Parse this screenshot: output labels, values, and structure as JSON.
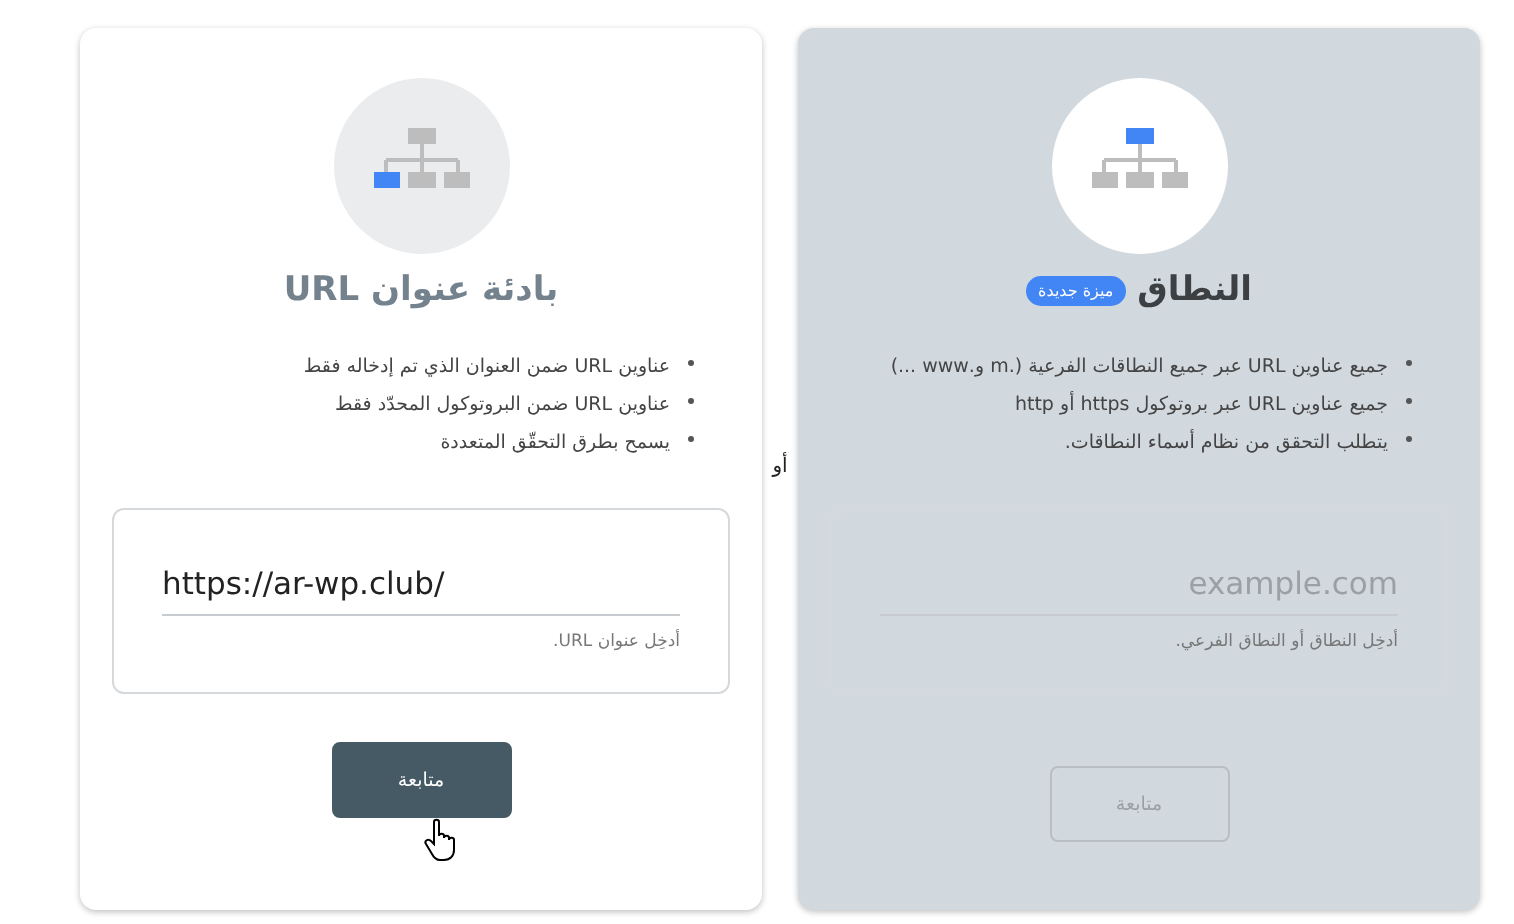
{
  "separator": "أو",
  "cards": [
    {
      "kind": "domain",
      "selected": false,
      "title": "النطاق",
      "badge": "ميزة جديدة",
      "bullets": [
        "جميع عناوين URL عبر جميع النطاقات الفرعية (.m و.www ...)",
        "جميع عناوين URL عبر بروتوكول https أو http",
        "يتطلب التحقق من نظام أسماء النطاقات."
      ],
      "field": {
        "placeholder": "example.com",
        "helper": "أدخِل النطاق أو النطاق الفرعي."
      },
      "button": {
        "label": "متابعة",
        "disabled": true
      }
    },
    {
      "kind": "url-prefix",
      "selected": true,
      "title": "بادئة عنوان URL",
      "bullets": [
        "عناوين URL ضمن العنوان الذي تم إدخاله فقط",
        "عناوين URL ضمن البروتوكول المحدّد فقط",
        "يسمح بطرق التحقّق المتعددة"
      ],
      "field": {
        "value": "https://ar-wp.club/",
        "helper": "أدخِل عنوان URL."
      },
      "button": {
        "label": "متابعة",
        "disabled": false
      }
    }
  ]
}
